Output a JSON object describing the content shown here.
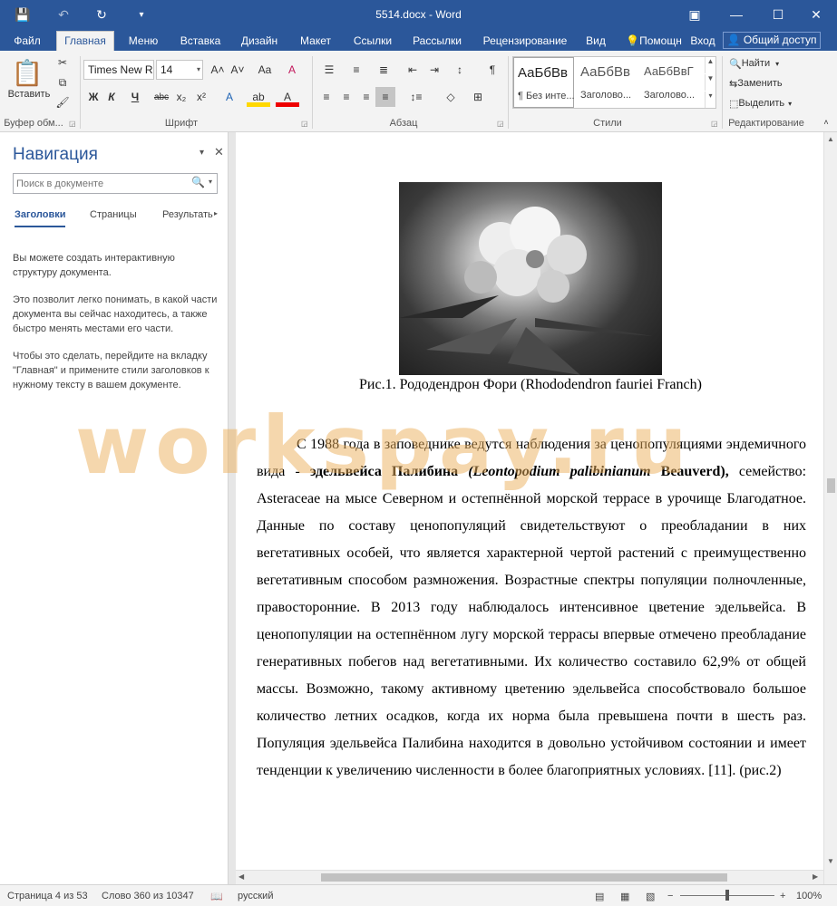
{
  "window": {
    "title": "5514.docx - Word",
    "minimize_icon": "—",
    "maximize_icon": "☐",
    "close_icon": "✕",
    "ribbon_display_icon": "▣"
  },
  "quick_access": {
    "save_icon": "💾",
    "undo_icon": "↶",
    "redo_icon": "↻",
    "customize_icon": "▾"
  },
  "tabs": [
    {
      "label": "Файл"
    },
    {
      "label": "Главная"
    },
    {
      "label": "Меню"
    },
    {
      "label": "Вставка"
    },
    {
      "label": "Дизайн"
    },
    {
      "label": "Макет"
    },
    {
      "label": "Ссылки"
    },
    {
      "label": "Рассылки"
    },
    {
      "label": "Рецензирование"
    },
    {
      "label": "Вид"
    },
    {
      "label": "Помощн"
    },
    {
      "label": "Вход"
    }
  ],
  "share_label": "Общий доступ",
  "ribbon": {
    "paste_label": "Вставить",
    "clipboard_label": "Буфер обм...",
    "font_label": "Шрифт",
    "paragraph_label": "Абзац",
    "styles_label": "Стили",
    "editing_label": "Редактирование",
    "font_name": "Times New R",
    "font_size": "14",
    "grow_font": "A˄",
    "shrink_font": "A˅",
    "change_case": "Aa",
    "clear_format": "A",
    "bold": "Ж",
    "italic": "К",
    "underline": "Ч",
    "strike": "abc",
    "subscript": "x₂",
    "superscript": "x²",
    "text_effects": "A",
    "highlight": "ab",
    "font_color": "A",
    "bullets": "☰",
    "numbering": "≡",
    "multilevel": "≣",
    "decrease_indent": "⇤",
    "increase_indent": "⇥",
    "sort": "↕",
    "pilcrow": "¶",
    "align_left": "≡",
    "align_center": "≡",
    "align_right": "≡",
    "justify": "≡",
    "line_spacing": "↕≡",
    "shading": "◇",
    "borders": "⊞",
    "styles": [
      {
        "sample": "АаБбВв",
        "name": "¶ Без инте..."
      },
      {
        "sample": "АаБбВв",
        "name": "Заголово..."
      },
      {
        "sample": "АаБбВвГ",
        "name": "Заголово..."
      }
    ],
    "find_label": "Найти",
    "replace_label": "Заменить",
    "select_label": "Выделить"
  },
  "navigation": {
    "title": "Навигация",
    "search_placeholder": "Поиск в документе",
    "tabs": [
      "Заголовки",
      "Страницы",
      "Результать"
    ],
    "para1": "Вы можете создать интерактивную структуру документа.",
    "para2": "Это позволит легко понимать, в какой части документа вы сейчас находитесь, а также быстро менять местами его части.",
    "para3": "Чтобы это сделать, перейдите на вкладку \"Главная\" и примените стили заголовков к нужному тексту в вашем документе."
  },
  "document": {
    "caption": "Рис.1. Рододендрон Фори (Rhododendron fauriei Franch)",
    "p_start": "С 1988 года в заповеднике ведутся наблюдения за ценопопуляциями эндемичного вида - ",
    "p_bold": "эдельвейса Палибина ",
    "p_bolditalic": "(Leontopodium palibinianum",
    "p_bold2": "Beauverd),",
    "p_rest": " семейство: Asteraceae на мысе Северном и остепнённой морской террасе в урочище Благодатное. Данные по составу ценопопуляций свидетельствуют о преобладании в них вегетативных особей, что является характерной чертой растений с преимущественно вегетативным способом размножения. Возрастные спектры популяции полночленные, правосторонние. В 2013 году наблюдалось интенсивное цветение эдельвейса. В ценопопуляции на остепнённом лугу морской террасы впервые отмечено преобладание генеративных побегов над вегетативными. Их количество составило 62,9% от общей массы. Возможно, такому активному цветению эдельвейса способствовало большое количество летних осадков, когда их норма была превышена почти в шесть раз. Популяция эдельвейса Палибина находится в довольно устойчивом состоянии и имеет тенденции к увеличению численности в более благоприятных условиях. [11]. (рис.2)",
    "watermark": "workspay.ru"
  },
  "status": {
    "page": "Страница 4 из 53",
    "words": "Слово 360 из 10347",
    "language": "русский",
    "zoom": "100%"
  }
}
